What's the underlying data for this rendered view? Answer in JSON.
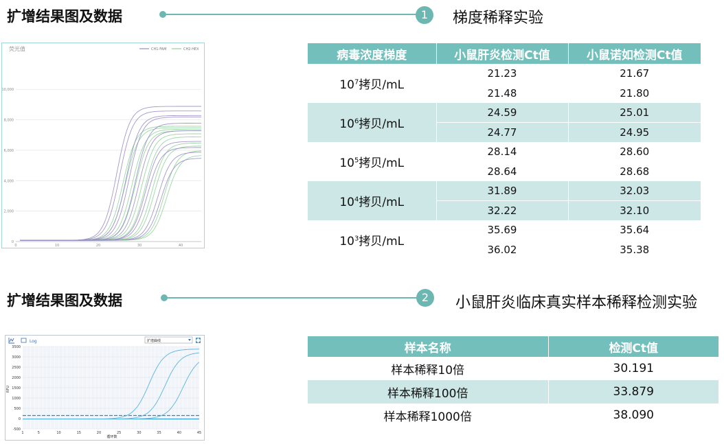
{
  "section1": {
    "title": "扩增结果图及数据",
    "number": "1",
    "experiment": "梯度稀释实验",
    "chart": {
      "ylabel": "荧光值",
      "legend": [
        "CH1-FAM",
        "CH2-HEX"
      ],
      "y_ticks": [
        "10,000",
        "8,000",
        "6,000",
        "4,000",
        "2,000",
        "0"
      ],
      "x_ticks": [
        "0",
        "10",
        "20",
        "30",
        "40"
      ]
    },
    "table": {
      "headers": [
        "病毒浓度梯度",
        "小鼠肝炎检测Ct值",
        "小鼠诺如检测Ct值"
      ],
      "groups": [
        {
          "base": "10",
          "exp": "7",
          "unit": "拷贝/mL",
          "rows": [
            [
              "21.23",
              "21.67"
            ],
            [
              "21.48",
              "21.80"
            ]
          ]
        },
        {
          "base": "10",
          "exp": "6",
          "unit": "拷贝/mL",
          "rows": [
            [
              "24.59",
              "25.01"
            ],
            [
              "24.77",
              "24.95"
            ]
          ]
        },
        {
          "base": "10",
          "exp": "5",
          "unit": "拷贝/mL",
          "rows": [
            [
              "28.14",
              "28.60"
            ],
            [
              "28.64",
              "28.68"
            ]
          ]
        },
        {
          "base": "10",
          "exp": "4",
          "unit": "拷贝/mL",
          "rows": [
            [
              "31.89",
              "32.03"
            ],
            [
              "32.22",
              "32.10"
            ]
          ]
        },
        {
          "base": "10",
          "exp": "3",
          "unit": "拷贝/mL",
          "rows": [
            [
              "35.69",
              "35.64"
            ],
            [
              "36.02",
              "35.38"
            ]
          ]
        }
      ]
    }
  },
  "section2": {
    "title": "扩增结果图及数据",
    "number": "2",
    "experiment": "小鼠肝炎临床真实样本稀释检测实验",
    "chart": {
      "toolbar": {
        "log_label": "Log",
        "select_value": "扩增曲线"
      },
      "ylabel": "RFU",
      "xlabel": "循环数",
      "y_ticks": [
        "3500",
        "3000",
        "2500",
        "2000",
        "1500",
        "1000",
        "500",
        "0",
        "-500"
      ],
      "x_ticks": [
        "1",
        "5",
        "10",
        "15",
        "20",
        "25",
        "30",
        "35",
        "40",
        "45"
      ]
    },
    "table": {
      "headers": [
        "样本名称",
        "检测Ct值"
      ],
      "rows": [
        [
          "样本稀释10倍",
          "30.191"
        ],
        [
          "样本稀释100倍",
          "33.879"
        ],
        [
          "样本稀释1000倍",
          "38.090"
        ]
      ]
    }
  },
  "colors": {
    "accent": "#6db7b3",
    "header_bg": "#72bfbb",
    "row_shade": "#cde6e6",
    "fam": "#9a8bc6",
    "hex": "#8fd39a",
    "curve2": "#5bb4e0",
    "threshold": "#1a8fd0"
  }
}
